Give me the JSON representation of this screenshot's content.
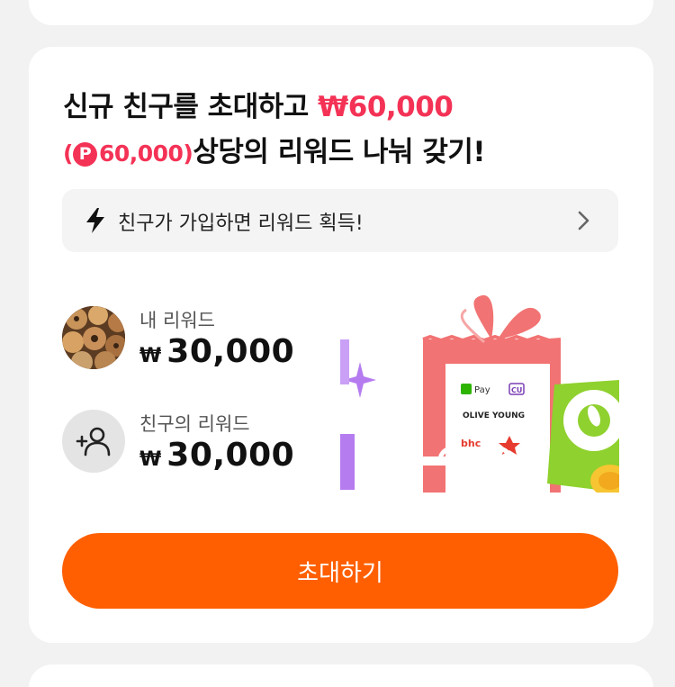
{
  "headline": {
    "line1_text": "신규 친구를 초대하고 ",
    "line1_amount": "₩60,000",
    "point_open": "(",
    "point_icon": "P",
    "point_amount": "60,000)",
    "line2_text": "상당의 리워드 나눠 갖기!"
  },
  "info": {
    "icon": "lightning-icon",
    "label": "친구가 가입하면 리워드 획득!",
    "chevron": "chevron-right-icon"
  },
  "rewards": {
    "mine": {
      "label": "내 리워드",
      "currency": "₩",
      "amount": "30,000"
    },
    "friend": {
      "label": "친구의 리워드",
      "currency": "₩",
      "amount": "30,000"
    }
  },
  "gift": {
    "brands": [
      "Pay",
      "CU",
      "OLIVE YOUNG",
      "bhc"
    ]
  },
  "button": {
    "label": "초대하기"
  },
  "colors": {
    "accent_red": "#f43256",
    "button_orange": "#ff5f00",
    "card_bg": "#ffffff",
    "page_bg": "#f2f2f2"
  }
}
